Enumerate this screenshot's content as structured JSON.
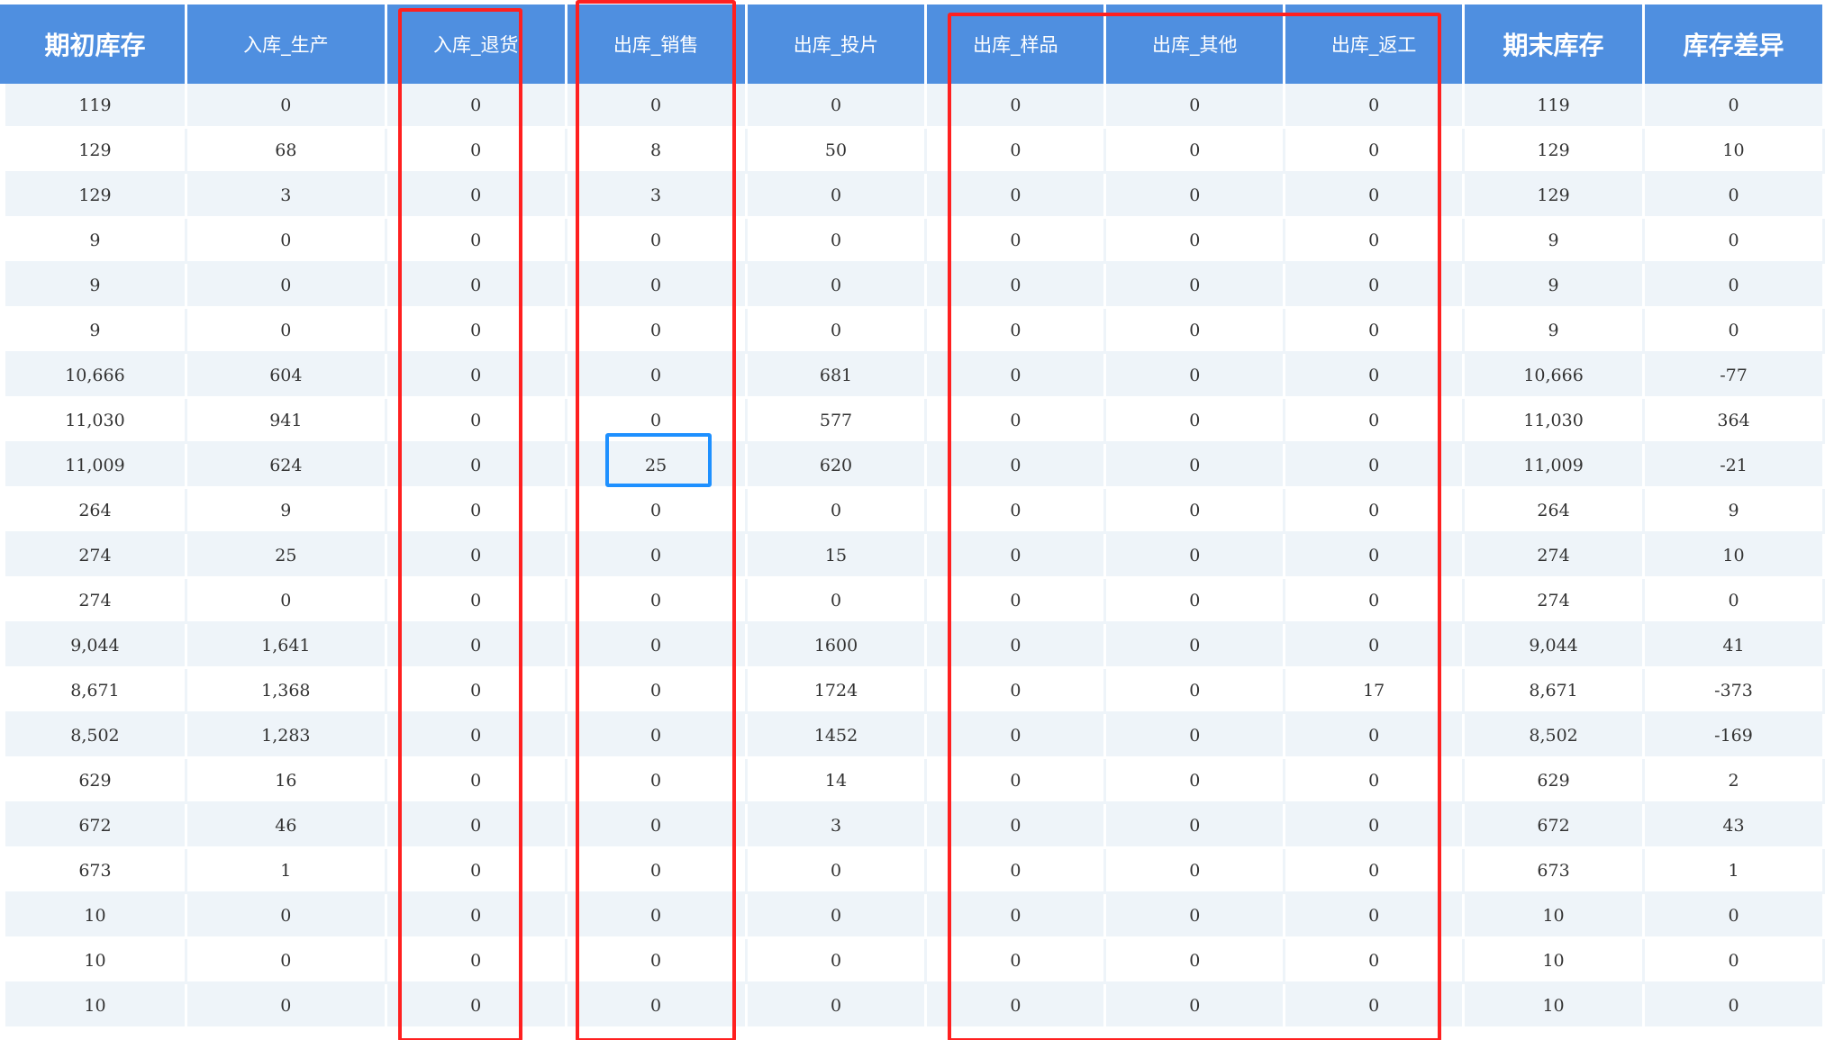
{
  "table": {
    "headers": [
      "期初库存",
      "入库_生产",
      "入库_退货",
      "出库_销售",
      "出库_投片",
      "出库_样品",
      "出库_其他",
      "出库_返工",
      "期末库存",
      "库存差异"
    ],
    "rows": [
      [
        "119",
        "0",
        "0",
        "0",
        "0",
        "0",
        "0",
        "0",
        "119",
        "0"
      ],
      [
        "129",
        "68",
        "0",
        "8",
        "50",
        "0",
        "0",
        "0",
        "129",
        "10"
      ],
      [
        "129",
        "3",
        "0",
        "3",
        "0",
        "0",
        "0",
        "0",
        "129",
        "0"
      ],
      [
        "9",
        "0",
        "0",
        "0",
        "0",
        "0",
        "0",
        "0",
        "9",
        "0"
      ],
      [
        "9",
        "0",
        "0",
        "0",
        "0",
        "0",
        "0",
        "0",
        "9",
        "0"
      ],
      [
        "9",
        "0",
        "0",
        "0",
        "0",
        "0",
        "0",
        "0",
        "9",
        "0"
      ],
      [
        "10,666",
        "604",
        "0",
        "0",
        "681",
        "0",
        "0",
        "0",
        "10,666",
        "-77"
      ],
      [
        "11,030",
        "941",
        "0",
        "0",
        "577",
        "0",
        "0",
        "0",
        "11,030",
        "364"
      ],
      [
        "11,009",
        "624",
        "0",
        "25",
        "620",
        "0",
        "0",
        "0",
        "11,009",
        "-21"
      ],
      [
        "264",
        "9",
        "0",
        "0",
        "0",
        "0",
        "0",
        "0",
        "264",
        "9"
      ],
      [
        "274",
        "25",
        "0",
        "0",
        "15",
        "0",
        "0",
        "0",
        "274",
        "10"
      ],
      [
        "274",
        "0",
        "0",
        "0",
        "0",
        "0",
        "0",
        "0",
        "274",
        "0"
      ],
      [
        "9,044",
        "1,641",
        "0",
        "0",
        "1600",
        "0",
        "0",
        "0",
        "9,044",
        "41"
      ],
      [
        "8,671",
        "1,368",
        "0",
        "0",
        "1724",
        "0",
        "0",
        "17",
        "8,671",
        "-373"
      ],
      [
        "8,502",
        "1,283",
        "0",
        "0",
        "1452",
        "0",
        "0",
        "0",
        "8,502",
        "-169"
      ],
      [
        "629",
        "16",
        "0",
        "0",
        "14",
        "0",
        "0",
        "0",
        "629",
        "2"
      ],
      [
        "672",
        "46",
        "0",
        "0",
        "3",
        "0",
        "0",
        "0",
        "672",
        "43"
      ],
      [
        "673",
        "1",
        "0",
        "0",
        "0",
        "0",
        "0",
        "0",
        "673",
        "1"
      ],
      [
        "10",
        "0",
        "0",
        "0",
        "0",
        "0",
        "0",
        "0",
        "10",
        "0"
      ],
      [
        "10",
        "0",
        "0",
        "0",
        "0",
        "0",
        "0",
        "0",
        "10",
        "0"
      ],
      [
        "10",
        "0",
        "0",
        "0",
        "0",
        "0",
        "0",
        "0",
        "10",
        "0"
      ]
    ]
  },
  "colors": {
    "header_bg": "#4f8fe0",
    "stripe_bg": "#eef4f9",
    "highlight_red": "#ff2020",
    "highlight_blue": "#1e90ff"
  }
}
